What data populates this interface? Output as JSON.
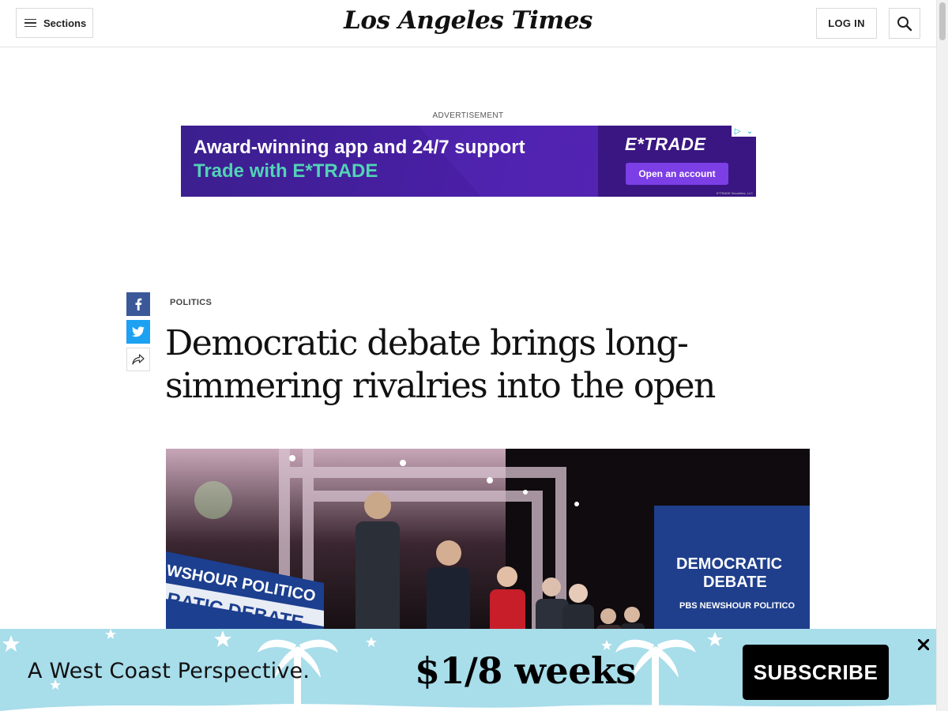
{
  "header": {
    "sections_label": "Sections",
    "logo_text": "Los Angeles Times",
    "login_label": "LOG IN"
  },
  "ad": {
    "label": "ADVERTISEMENT",
    "line1": "Award-winning app and 24/7 support",
    "line2": "Trade with E*TRADE",
    "brand": "E*TRADE",
    "cta": "Open an account",
    "fine_print": "E*TRADE Securities, LLC"
  },
  "article": {
    "section": "POLITICS",
    "headline": "Democratic debate brings long-simmering rivalries into the open",
    "image_sign_left_top": "WSHOUR POLITICO",
    "image_sign_left_bottom": "RATIC DEBATE",
    "image_sign_right_line1": "DEMOCRATIC",
    "image_sign_right_line2": "DEBATE",
    "image_sign_right_line3": "PBS NEWSHOUR POLITICO"
  },
  "subscribe": {
    "tagline": "A West Coast Perspective.",
    "price": "$1/8 weeks",
    "button": "SUBSCRIBE"
  },
  "colors": {
    "facebook": "#3b5998",
    "twitter": "#1da1f2",
    "subscribe_bg": "#a8ddea",
    "ad_purple": "#4b1fa8",
    "ad_teal": "#52d3b6"
  }
}
